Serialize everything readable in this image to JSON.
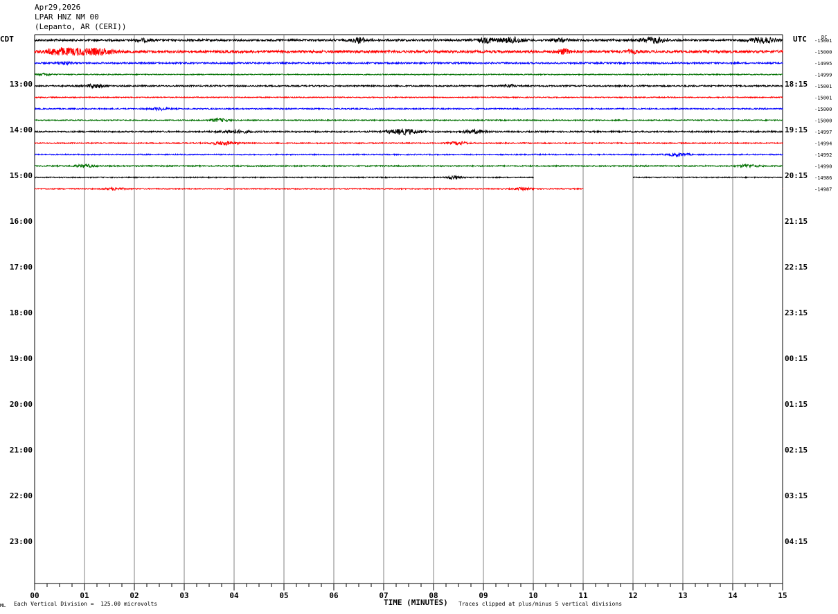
{
  "header": {
    "date": "Apr29,2026",
    "station": "LPAR HNZ NM 00",
    "location": "(Lepanto, AR (CERI))"
  },
  "left_tz": "CDT",
  "right_tz": "UTC",
  "dc_label": "DC",
  "footer": {
    "division": "Each Vertical Division =  125.00 microvolts",
    "xtitle": "TIME (MINUTES)",
    "clipped": "Traces clipped at plus/minus 5 vertical divisions",
    "corner": "ML"
  },
  "colors": {
    "cycle": [
      "#000000",
      "#ff0000",
      "#0000ff",
      "#007000"
    ],
    "grid": "#808080"
  },
  "chart_data": {
    "type": "line",
    "title": "LPAR HNZ NM 00",
    "xlabel": "TIME (MINUTES)",
    "xlim": [
      0,
      15
    ],
    "x_ticks": [
      "00",
      "01",
      "02",
      "03",
      "04",
      "05",
      "06",
      "07",
      "08",
      "09",
      "10",
      "11",
      "12",
      "13",
      "14",
      "15"
    ],
    "hours": [
      {
        "local": "13:00",
        "utc": "18:15"
      },
      {
        "local": "14:00",
        "utc": "19:15"
      },
      {
        "local": "15:00",
        "utc": "20:15"
      },
      {
        "local": "16:00",
        "utc": "21:15"
      },
      {
        "local": "17:00",
        "utc": "22:15"
      },
      {
        "local": "18:00",
        "utc": "23:15"
      },
      {
        "local": "19:00",
        "utc": "00:15"
      },
      {
        "local": "20:00",
        "utc": "01:15"
      },
      {
        "local": "21:00",
        "utc": "02:15"
      },
      {
        "local": "22:00",
        "utc": "03:15"
      },
      {
        "local": "23:00",
        "utc": "04:15"
      }
    ],
    "traces": [
      {
        "dc": "-15001",
        "gaps": [],
        "bursts": [
          [
            6.5,
            0.25,
            2.2
          ],
          [
            9.1,
            0.35,
            2.0
          ],
          [
            9.6,
            0.3,
            2.6
          ],
          [
            10.5,
            0.3,
            1.4
          ],
          [
            12.4,
            0.4,
            2.4
          ],
          [
            14.6,
            0.4,
            2.2
          ],
          [
            2.2,
            0.3,
            1.0
          ]
        ],
        "amp": 0.9
      },
      {
        "dc": "-15000",
        "gaps": [],
        "bursts": [
          [
            0.5,
            0.4,
            3.0
          ],
          [
            1.3,
            0.5,
            2.4
          ],
          [
            0.9,
            0.3,
            2.0
          ],
          [
            10.6,
            0.2,
            2.0
          ],
          [
            12.0,
            0.2,
            1.2
          ]
        ],
        "amp": 1.1
      },
      {
        "dc": "-14995",
        "gaps": [],
        "bursts": [
          [
            0.6,
            0.2,
            1.2
          ]
        ],
        "amp": 0.7
      },
      {
        "dc": "-14999",
        "gaps": [],
        "bursts": [
          [
            0.2,
            0.2,
            1.0
          ]
        ],
        "amp": 0.45
      },
      {
        "dc": "-15001",
        "gaps": [],
        "bursts": [
          [
            1.2,
            0.3,
            1.6
          ],
          [
            9.5,
            0.2,
            1.2
          ]
        ],
        "amp": 0.65
      },
      {
        "dc": "-15001",
        "gaps": [],
        "bursts": [],
        "amp": 0.45
      },
      {
        "dc": "-15000",
        "gaps": [],
        "bursts": [
          [
            2.5,
            0.3,
            1.0
          ]
        ],
        "amp": 0.55
      },
      {
        "dc": "-15000",
        "gaps": [],
        "bursts": [
          [
            3.7,
            0.3,
            1.4
          ]
        ],
        "amp": 0.5
      },
      {
        "dc": "-14997",
        "gaps": [],
        "bursts": [
          [
            4.0,
            0.5,
            1.2
          ],
          [
            7.4,
            0.5,
            2.2
          ],
          [
            8.8,
            0.4,
            1.4
          ]
        ],
        "amp": 0.65
      },
      {
        "dc": "-14994",
        "gaps": [],
        "bursts": [
          [
            3.8,
            0.4,
            1.4
          ],
          [
            8.5,
            0.3,
            1.2
          ]
        ],
        "amp": 0.5
      },
      {
        "dc": "-14992",
        "gaps": [],
        "bursts": [
          [
            12.9,
            0.3,
            1.4
          ]
        ],
        "amp": 0.5
      },
      {
        "dc": "-14990",
        "gaps": [],
        "bursts": [
          [
            1.0,
            0.3,
            1.2
          ],
          [
            14.3,
            0.3,
            1.2
          ]
        ],
        "amp": 0.55
      },
      {
        "dc": "-14986",
        "gaps": [
          [
            10.0,
            12.0
          ]
        ],
        "bursts": [
          [
            8.4,
            0.2,
            1.6
          ]
        ],
        "amp": 0.45
      },
      {
        "dc": "-14987",
        "gaps": [
          [
            11.0,
            15.0
          ]
        ],
        "bursts": [
          [
            1.6,
            0.3,
            1.0
          ],
          [
            9.8,
            0.3,
            1.0
          ]
        ],
        "amp": 0.45
      }
    ]
  }
}
